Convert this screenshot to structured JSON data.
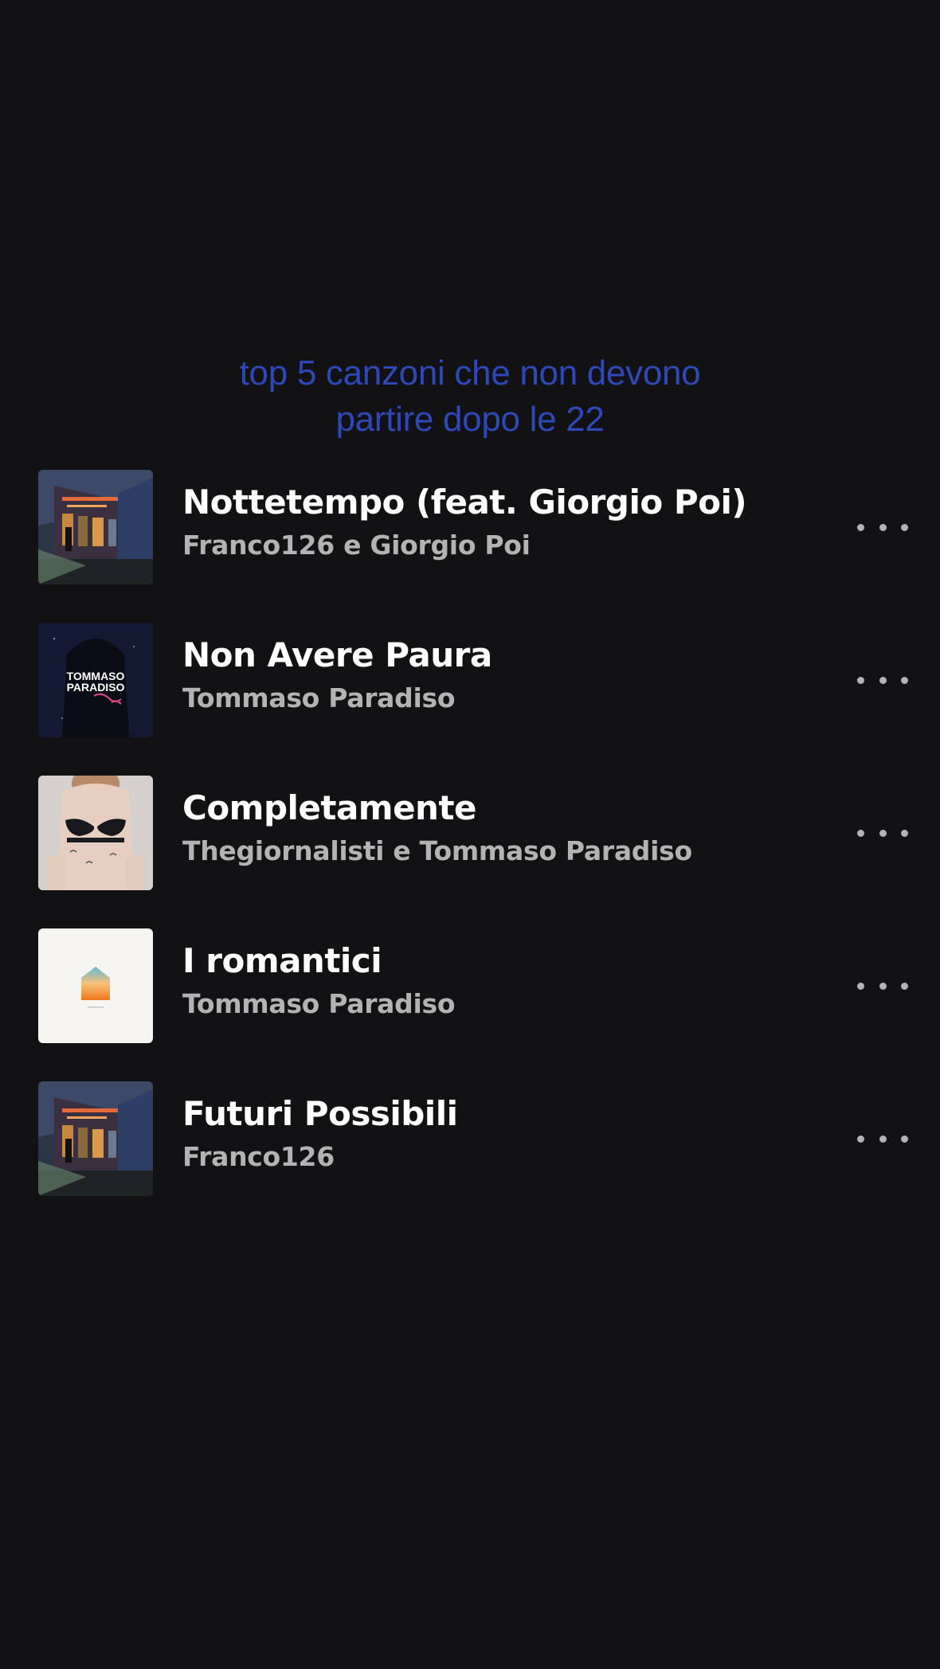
{
  "playlist": {
    "title_line1": "top 5 canzoni che non devono",
    "title_line2": "partire dopo le 22",
    "title_color": "#2e48b8"
  },
  "tracks": [
    {
      "title": "Nottetempo (feat. Giorgio Poi)",
      "artist": "Franco126 e Giorgio Poi",
      "cover": "night-train-cover"
    },
    {
      "title": "Non Avere Paura",
      "artist": "Tommaso Paradiso",
      "cover": "tommaso-paradiso-cover"
    },
    {
      "title": "Completamente",
      "artist": "Thegiornalisti e Tommaso Paradiso",
      "cover": "tattooed-woman-cover"
    },
    {
      "title": "I romantici",
      "artist": "Tommaso Paradiso",
      "cover": "white-house-cover"
    },
    {
      "title": "Futuri Possibili",
      "artist": "Franco126",
      "cover": "night-train-cover"
    }
  ],
  "cover_text": {
    "line1": "TOMMASO",
    "line2": "PARADISO"
  },
  "icons": {
    "more": "more-options-icon"
  }
}
